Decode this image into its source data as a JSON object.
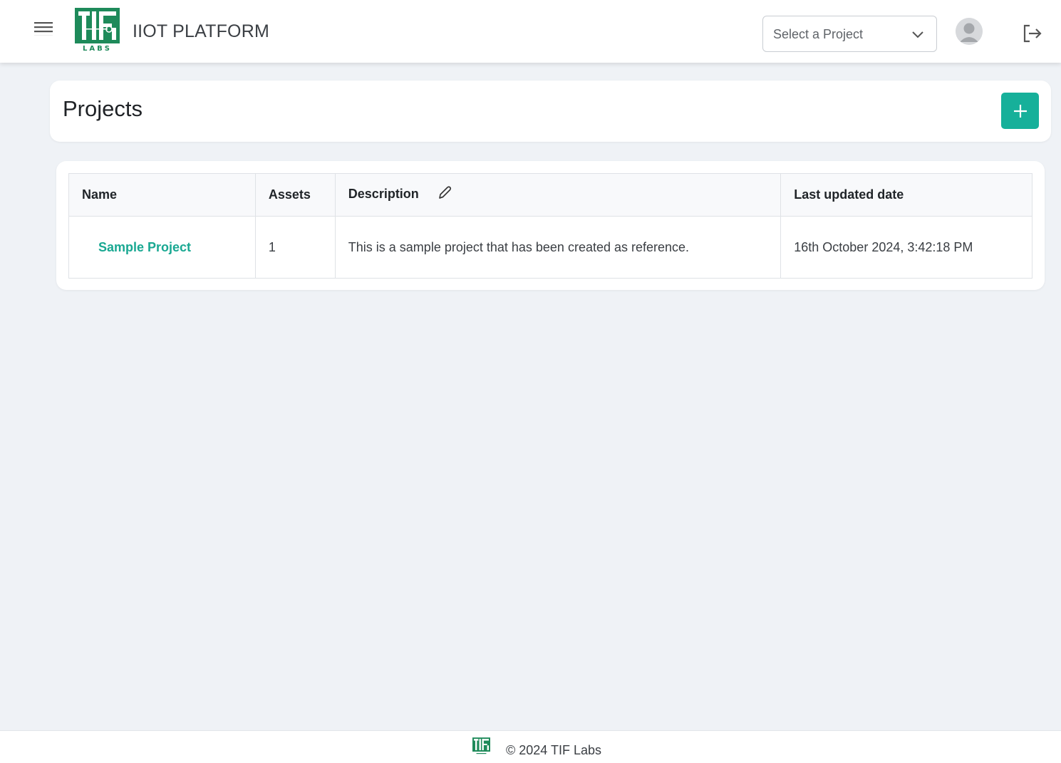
{
  "header": {
    "app_title": "IIOT PLATFORM",
    "logo_text": "TIF LABS",
    "project_select": {
      "placeholder": "Select a Project"
    },
    "icons": [
      "menu-icon",
      "chevron-down-icon",
      "user-avatar-icon",
      "logout-icon"
    ]
  },
  "page": {
    "title": "Projects",
    "add_button_icon": "plus-icon"
  },
  "table": {
    "columns": [
      "Name",
      "Assets",
      "Description",
      "Last updated date"
    ],
    "rows": [
      {
        "name": "Sample Project",
        "assets": "1",
        "description": "This is a sample project that has been created as reference.",
        "last_updated": "16th October 2024, 3:42:18 PM"
      }
    ]
  },
  "footer": {
    "text": "© 2024 TIF Labs"
  },
  "colors": {
    "accent": "#16b09a",
    "logo_green": "#1e8a5a",
    "background": "#eff2f6"
  }
}
